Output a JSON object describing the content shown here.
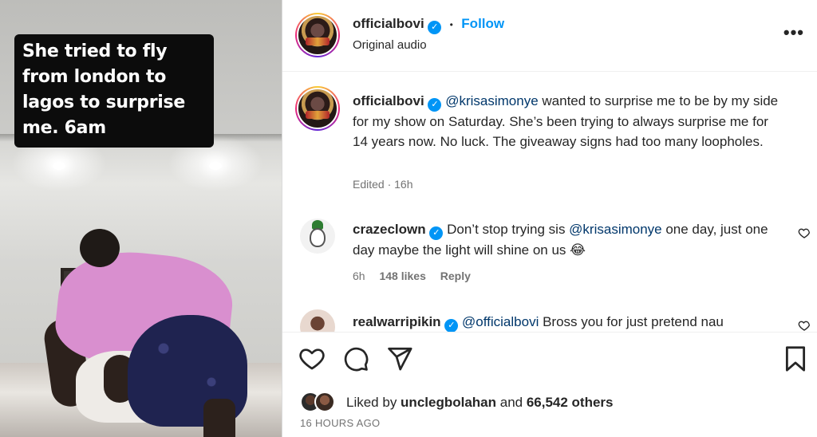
{
  "video": {
    "caption": "She tried to fly from london to lagos to surprise me. 6am"
  },
  "header": {
    "username": "officialbovi",
    "separator": "•",
    "follow_label": "Follow",
    "subtitle": "Original audio",
    "more_icon": "more-horizontal-icon"
  },
  "post": {
    "username": "officialbovi",
    "mention": "@krisasimonye",
    "text": " wanted to surprise me to be by my side for my show on Saturday. She’s been trying to always surprise me for 14 years now. No luck. The giveaway signs had too many loopholes.",
    "meta": "Edited · 16h"
  },
  "comments": [
    {
      "username": "crazeclown",
      "text_before": " Don’t stop trying sis ",
      "mention": "@krisasimonye",
      "text_after": " one day, just one day maybe the light will shine on us 😂",
      "time": "6h",
      "likes": "148 likes",
      "reply": "Reply"
    },
    {
      "username": "realwarripikin",
      "mention": "@officialbovi",
      "text_after": " Bross you for just pretend nau"
    }
  ],
  "actions": {
    "like_icon": "heart-icon",
    "comment_icon": "comment-icon",
    "share_icon": "send-icon",
    "save_icon": "bookmark-icon"
  },
  "likes": {
    "prefix": "Liked by ",
    "user": "unclegbolahan",
    "middle": " and ",
    "count": "66,542 others"
  },
  "timestamp": "16 HOURS AGO",
  "colors": {
    "accent_blue": "#0095f6",
    "mention_blue": "#00376b",
    "muted": "#737373",
    "caption_bg": "#0c0c0c"
  }
}
